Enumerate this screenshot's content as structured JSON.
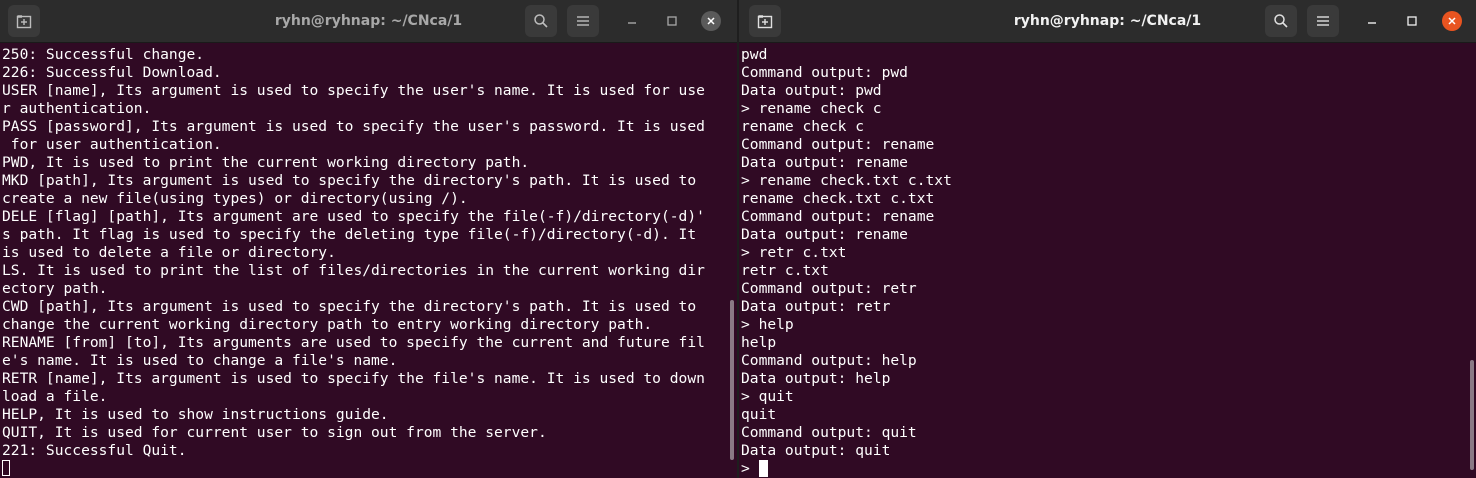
{
  "left_window": {
    "title": "ryhn@ryhnap: ~/CNca/1",
    "lines": [
      "250: Successful change.",
      "226: Successful Download.",
      "USER [name], Its argument is used to specify the user's name. It is used for use",
      "r authentication.",
      "PASS [password], Its argument is used to specify the user's password. It is used",
      " for user authentication.",
      "PWD, It is used to print the current working directory path.",
      "MKD [path], Its argument is used to specify the directory's path. It is used to",
      "create a new file(using types) or directory(using /).",
      "DELE [flag] [path], Its argument are used to specify the file(-f)/directory(-d)'",
      "s path. It flag is used to specify the deleting type file(-f)/directory(-d). It",
      "is used to delete a file or directory.",
      "LS. It is used to print the list of files/directories in the current working dir",
      "ectory path.",
      "CWD [path], Its argument is used to specify the directory's path. It is used to",
      "change the current working directory path to entry working directory path.",
      "RENAME [from] [to], Its arguments are used to specify the current and future fil",
      "e's name. It is used to change a file's name.",
      "RETR [name], Its argument is used to specify the file's name. It is used to down",
      "load a file.",
      "HELP, It is used to show instructions guide.",
      "QUIT, It is used for current user to sign out from the server.",
      "221: Successful Quit."
    ]
  },
  "right_window": {
    "title": "ryhn@ryhnap: ~/CNca/1",
    "lines": [
      "pwd",
      "Command output: pwd",
      "Data output: pwd",
      "> rename check c",
      "rename check c",
      "Command output: rename",
      "Data output: rename",
      "> rename check.txt c.txt",
      "rename check.txt c.txt",
      "Command output: rename",
      "Data output: rename",
      "> retr c.txt",
      "retr c.txt",
      "Command output: retr",
      "Data output: retr",
      "> help",
      "help",
      "Command output: help",
      "Data output: help",
      "> quit",
      "quit",
      "Command output: quit",
      "Data output: quit"
    ],
    "prompt": "> "
  },
  "icons": {
    "new_tab": "new-tab-icon",
    "search": "search-icon",
    "menu": "hamburger-menu-icon",
    "minimize": "minimize-icon",
    "maximize": "maximize-icon",
    "close": "close-icon"
  },
  "colors": {
    "terminal_bg": "#300a24",
    "titlebar_bg": "#2c2c2c",
    "text": "#ffffff",
    "close_active": "#e95420"
  }
}
